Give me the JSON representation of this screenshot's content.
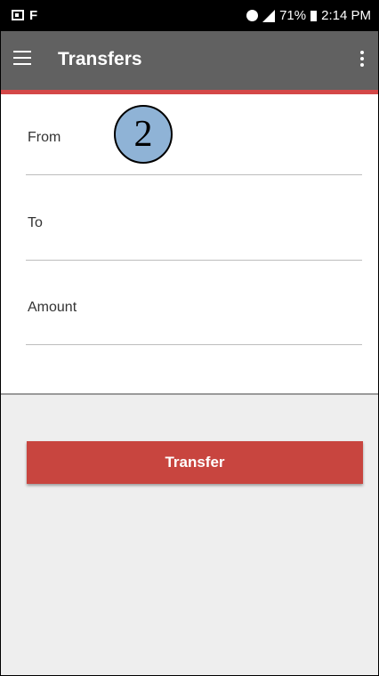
{
  "status_bar": {
    "battery": "71%",
    "time": "2:14 PM",
    "icons": [
      "image-icon",
      "flipboard-icon",
      "alarm-icon",
      "signal-icon",
      "battery-icon"
    ]
  },
  "app_bar": {
    "title": "Transfers",
    "background_color": "#616161",
    "accent_color": "#d44848"
  },
  "form": {
    "fields": [
      {
        "label": "From",
        "value": ""
      },
      {
        "label": "To",
        "value": ""
      },
      {
        "label": "Amount",
        "value": ""
      }
    ]
  },
  "step_badge": "2",
  "transfer_button": {
    "label": "Transfer",
    "color": "#c8453f"
  }
}
